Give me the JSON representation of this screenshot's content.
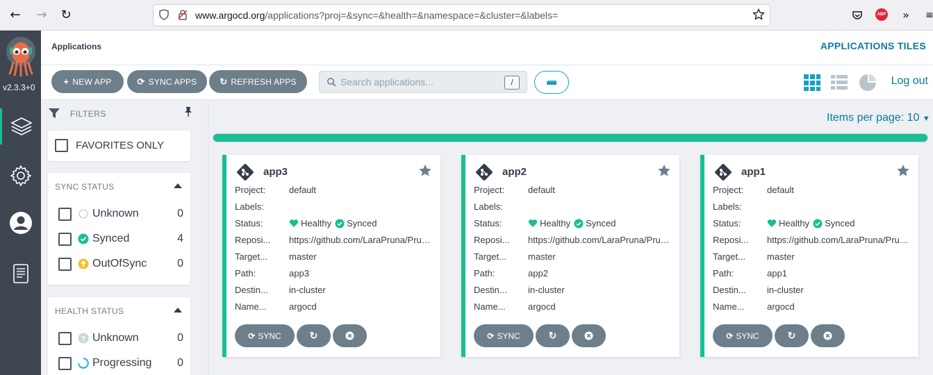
{
  "browser": {
    "url_host": "www.argocd.org",
    "url_path": "/applications?proj=&sync=&health=&namespace=&cluster=&labels=",
    "abp_label": "ABP"
  },
  "sidebar": {
    "version": "v2.3.3+0",
    "items": [
      {
        "name": "applications",
        "icon": "layers-icon",
        "active": true
      },
      {
        "name": "settings",
        "icon": "gear-icon",
        "active": false
      },
      {
        "name": "user-info",
        "icon": "user-icon",
        "active": false
      },
      {
        "name": "docs",
        "icon": "book-icon",
        "active": false
      }
    ]
  },
  "header": {
    "title": "Applications",
    "view_title": "APPLICATIONS TILES"
  },
  "toolbar": {
    "new_app": "NEW APP",
    "sync_apps": "SYNC APPS",
    "refresh_apps": "REFRESH APPS",
    "search_placeholder": "Search applications...",
    "search_shortcut": "/",
    "logout": "Log out"
  },
  "filters": {
    "title": "FILTERS",
    "favorites_label": "FAVORITES ONLY",
    "sync_status": {
      "title": "SYNC STATUS",
      "items": [
        {
          "label": "Unknown",
          "count": "0"
        },
        {
          "label": "Synced",
          "count": "4"
        },
        {
          "label": "OutOfSync",
          "count": "0"
        }
      ]
    },
    "health_status": {
      "title": "HEALTH STATUS",
      "items": [
        {
          "label": "Unknown",
          "count": "0"
        },
        {
          "label": "Progressing",
          "count": "0"
        }
      ]
    }
  },
  "main": {
    "items_per_page": "Items per page: 10",
    "progress_fraction": 1.0,
    "labels": {
      "project": "Project:",
      "labels": "Labels:",
      "status": "Status:",
      "repository": "Reposi...",
      "target": "Target...",
      "path": "Path:",
      "destination": "Destin...",
      "namespace": "Name..."
    },
    "sync_button": "SYNC",
    "apps": [
      {
        "name": "app3",
        "project": "default",
        "labels": "",
        "health": "Healthy",
        "sync": "Synced",
        "repository": "https://github.com/LaraPruna/Prueba",
        "target": "master",
        "path": "app3",
        "destination": "in-cluster",
        "namespace": "argocd"
      },
      {
        "name": "app2",
        "project": "default",
        "labels": "",
        "health": "Healthy",
        "sync": "Synced",
        "repository": "https://github.com/LaraPruna/Prueba",
        "target": "master",
        "path": "app2",
        "destination": "in-cluster",
        "namespace": "argocd"
      },
      {
        "name": "app1",
        "project": "default",
        "labels": "",
        "health": "Healthy",
        "sync": "Synced",
        "repository": "https://github.com/LaraPruna/Prueba",
        "target": "master",
        "path": "app1",
        "destination": "in-cluster",
        "namespace": "argocd"
      }
    ]
  },
  "colors": {
    "accent": "#18be94",
    "link": "#0c7b9b",
    "button": "#6d7f8b",
    "sidebar": "#3d4651"
  }
}
